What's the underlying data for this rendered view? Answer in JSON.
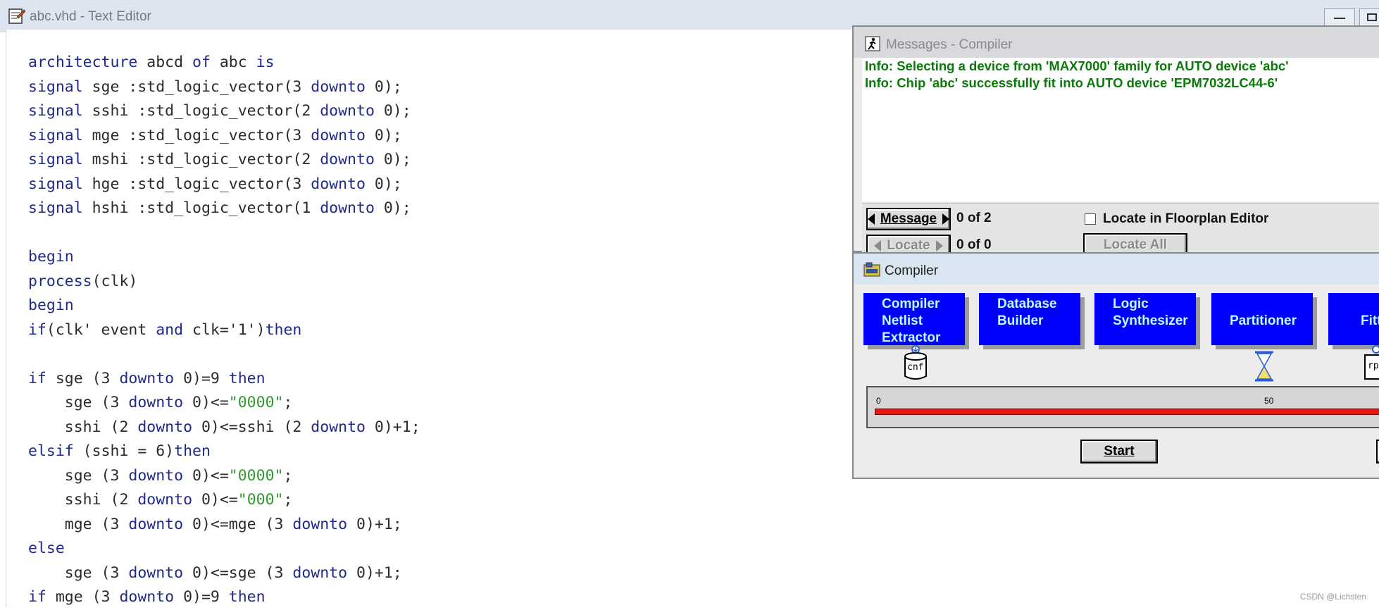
{
  "editor": {
    "title": "abc.vhd - Text Editor",
    "icon": "text-editor-icon",
    "code_lines": [
      [
        {
          "t": "architecture",
          "k": "kw"
        },
        {
          "t": " abcd "
        },
        {
          "t": "of",
          "k": "kw"
        },
        {
          "t": " abc "
        },
        {
          "t": "is",
          "k": "kw"
        }
      ],
      [
        {
          "t": "signal",
          "k": "kw"
        },
        {
          "t": " sge :std_logic_vector(3 "
        },
        {
          "t": "downto",
          "k": "kw"
        },
        {
          "t": " 0);"
        }
      ],
      [
        {
          "t": "signal",
          "k": "kw"
        },
        {
          "t": " sshi :std_logic_vector(2 "
        },
        {
          "t": "downto",
          "k": "kw"
        },
        {
          "t": " 0);"
        }
      ],
      [
        {
          "t": "signal",
          "k": "kw"
        },
        {
          "t": " mge :std_logic_vector(3 "
        },
        {
          "t": "downto",
          "k": "kw"
        },
        {
          "t": " 0);"
        }
      ],
      [
        {
          "t": "signal",
          "k": "kw"
        },
        {
          "t": " mshi :std_logic_vector(2 "
        },
        {
          "t": "downto",
          "k": "kw"
        },
        {
          "t": " 0);"
        }
      ],
      [
        {
          "t": "signal",
          "k": "kw"
        },
        {
          "t": " hge :std_logic_vector(3 "
        },
        {
          "t": "downto",
          "k": "kw"
        },
        {
          "t": " 0);"
        }
      ],
      [
        {
          "t": "signal",
          "k": "kw"
        },
        {
          "t": " hshi :std_logic_vector(1 "
        },
        {
          "t": "downto",
          "k": "kw"
        },
        {
          "t": " 0);"
        }
      ],
      [],
      [
        {
          "t": "begin",
          "k": "kw"
        }
      ],
      [
        {
          "t": "process",
          "k": "kw"
        },
        {
          "t": "(clk)"
        }
      ],
      [
        {
          "t": "begin",
          "k": "kw"
        }
      ],
      [
        {
          "t": "if",
          "k": "kw"
        },
        {
          "t": "(clk' event "
        },
        {
          "t": "and",
          "k": "kw"
        },
        {
          "t": " clk='1')"
        },
        {
          "t": "then",
          "k": "kw"
        }
      ],
      [],
      [
        {
          "t": "if",
          "k": "kw"
        },
        {
          "t": " sge (3 "
        },
        {
          "t": "downto",
          "k": "kw"
        },
        {
          "t": " 0)=9 "
        },
        {
          "t": "then",
          "k": "kw"
        }
      ],
      [
        {
          "t": "    sge (3 "
        },
        {
          "t": "downto",
          "k": "kw"
        },
        {
          "t": " 0)<="
        },
        {
          "t": "\"0000\"",
          "k": "str"
        },
        {
          "t": ";"
        }
      ],
      [
        {
          "t": "    sshi (2 "
        },
        {
          "t": "downto",
          "k": "kw"
        },
        {
          "t": " 0)<=sshi (2 "
        },
        {
          "t": "downto",
          "k": "kw"
        },
        {
          "t": " 0)+1;"
        }
      ],
      [
        {
          "t": "elsif",
          "k": "kw"
        },
        {
          "t": " (sshi = 6)"
        },
        {
          "t": "then",
          "k": "kw"
        }
      ],
      [
        {
          "t": "    sge (3 "
        },
        {
          "t": "downto",
          "k": "kw"
        },
        {
          "t": " 0)<="
        },
        {
          "t": "\"0000\"",
          "k": "str"
        },
        {
          "t": ";"
        }
      ],
      [
        {
          "t": "    sshi (2 "
        },
        {
          "t": "downto",
          "k": "kw"
        },
        {
          "t": " 0)<="
        },
        {
          "t": "\"000\"",
          "k": "str"
        },
        {
          "t": ";"
        }
      ],
      [
        {
          "t": "    mge (3 "
        },
        {
          "t": "downto",
          "k": "kw"
        },
        {
          "t": " 0)<=mge (3 "
        },
        {
          "t": "downto",
          "k": "kw"
        },
        {
          "t": " 0)+1;"
        }
      ],
      [
        {
          "t": "else",
          "k": "kw"
        }
      ],
      [
        {
          "t": "    sge (3 "
        },
        {
          "t": "downto",
          "k": "kw"
        },
        {
          "t": " 0)<=sge (3 "
        },
        {
          "t": "downto",
          "k": "kw"
        },
        {
          "t": " 0)+1;"
        }
      ],
      [
        {
          "t": "if",
          "k": "kw"
        },
        {
          "t": " mge (3 "
        },
        {
          "t": "downto",
          "k": "kw"
        },
        {
          "t": " 0)=9 "
        },
        {
          "t": "then",
          "k": "kw"
        }
      ]
    ]
  },
  "messages": {
    "title": "Messages - Compiler",
    "lines": [
      "Info: Selecting a device from 'MAX7000' family for AUTO device 'abc'",
      "Info: Chip 'abc' successfully fit into AUTO device 'EPM7032LC44-6'"
    ],
    "message_button": "Message",
    "message_count": "0 of 2",
    "locate_button": "Locate",
    "locate_count": "0 of 0",
    "locate_in_floorplan": "Locate in Floorplan Editor",
    "locate_all_button": "Locate All"
  },
  "compiler": {
    "title": "Compiler",
    "modules": [
      {
        "label": "Compiler\nNetlist\nExtractor",
        "icon": "cnf"
      },
      {
        "label": "Database\nBuilder"
      },
      {
        "label": "Logic\nSynthesizer"
      },
      {
        "label": "Partitioner"
      },
      {
        "label": "Fitt"
      }
    ],
    "file_icon_cnf": "cnf",
    "file_icon_rpt": "rp",
    "progress_ticks": [
      "0",
      "50"
    ],
    "progress": 1.0,
    "start_button": "Start"
  },
  "watermark": "CSDN @Lichsten",
  "colors": {
    "keyword": "#1f2a8c",
    "string": "#2e9a2e",
    "info": "#0a7a0a",
    "module": "#0000ff",
    "module_text": "#b8ffff",
    "progress": "#ee1111"
  }
}
